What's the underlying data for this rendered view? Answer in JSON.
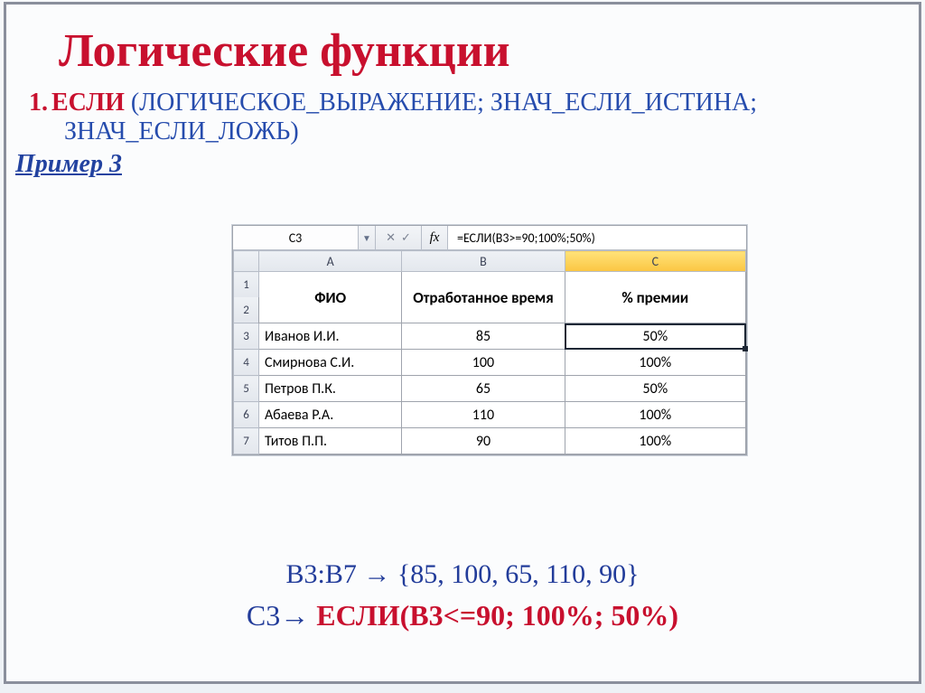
{
  "title": "Логические функции",
  "list_number": "1.",
  "func_name": "ЕСЛИ",
  "syntax_part1": " (ЛОГИЧЕСКОЕ_ВЫРАЖЕНИЕ; ЗНАЧ_ЕСЛИ_ИСТИНА;",
  "syntax_part2": "ЗНАЧ_ЕСЛИ_ЛОЖЬ)",
  "example_label": "Пример 3",
  "formula_bar": {
    "cell_name": "C3",
    "fx_label": "fx",
    "formula": "=ЕСЛИ(B3>=90;100%;50%)"
  },
  "columns": [
    "A",
    "B",
    "C"
  ],
  "header_row": {
    "a": "ФИО",
    "b": "Отработанное время",
    "c": "% премии"
  },
  "rows": [
    {
      "n": "3",
      "a": "Иванов И.И.",
      "b": "85",
      "c": "50%"
    },
    {
      "n": "4",
      "a": "Смирнова С.И.",
      "b": "100",
      "c": "100%"
    },
    {
      "n": "5",
      "a": "Петров П.К.",
      "b": "65",
      "c": "50%"
    },
    {
      "n": "6",
      "a": "Абаева Р.А.",
      "b": "110",
      "c": "100%"
    },
    {
      "n": "7",
      "a": "Титов П.П.",
      "b": "90",
      "c": "100%"
    }
  ],
  "rowlabel1": "1",
  "rowlabel2": "2",
  "bottom": {
    "line1_ref": "B3:B7",
    "line1_arrow": " → ",
    "line1_set": "{85, 100, 65, 110, 90}",
    "line2_ref": "C3",
    "line2_arrow": "→ ",
    "line2_formula": "ЕСЛИ(B3<=90; 100%; 50%)"
  }
}
